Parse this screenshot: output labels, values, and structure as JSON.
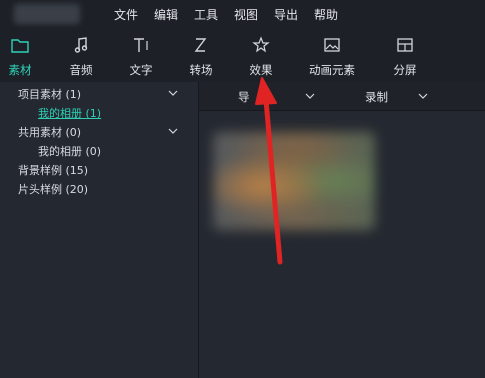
{
  "menu": {
    "items": [
      "文件",
      "编辑",
      "工具",
      "视图",
      "导出",
      "帮助"
    ]
  },
  "toolbar": {
    "tabs": [
      {
        "label": "素材",
        "icon": "folder-icon",
        "active": true
      },
      {
        "label": "音频",
        "icon": "music-note-icon",
        "active": false
      },
      {
        "label": "文字",
        "icon": "text-icon",
        "active": false
      },
      {
        "label": "转场",
        "icon": "transition-icon",
        "active": false
      },
      {
        "label": "效果",
        "icon": "effects-icon",
        "active": false
      },
      {
        "label": "动画元素",
        "icon": "image-icon",
        "active": false
      },
      {
        "label": "分屏",
        "icon": "split-screen-icon",
        "active": false
      }
    ]
  },
  "sidebar": {
    "items": [
      {
        "label": "项目素材 (1)",
        "indent": 0,
        "expandable": true
      },
      {
        "label": "我的相册 (1)",
        "indent": 1,
        "selected": true
      },
      {
        "label": "共用素材 (0)",
        "indent": 0,
        "expandable": true
      },
      {
        "label": "我的相册 (0)",
        "indent": 1
      },
      {
        "label": "背景样例 (15)",
        "indent": 0
      },
      {
        "label": "片头样例 (20)",
        "indent": 0
      }
    ]
  },
  "main": {
    "import_label": "导",
    "record_label": "录制"
  },
  "colors": {
    "accent": "#2fd0b7",
    "annotation_arrow": "#e02424"
  }
}
